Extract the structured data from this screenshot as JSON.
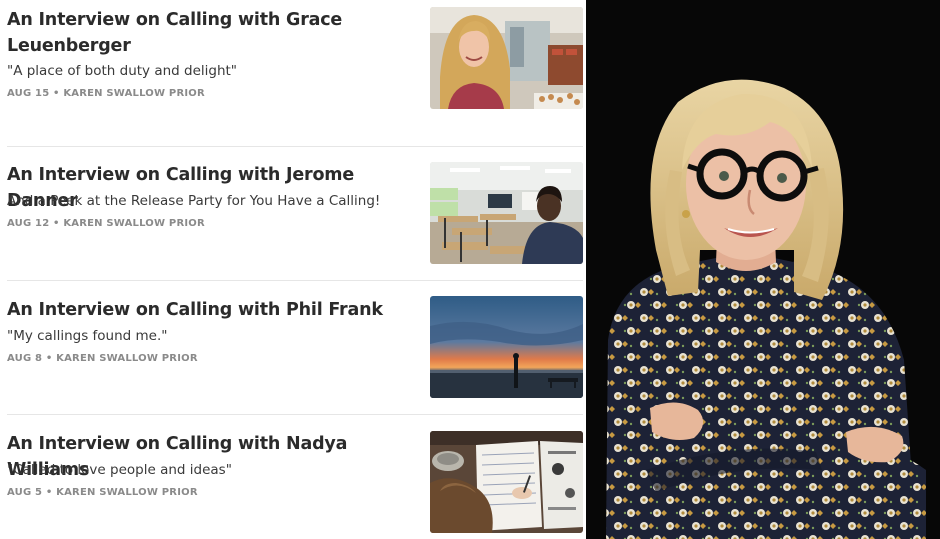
{
  "posts": [
    {
      "title": "An Interview on Calling with Grace Leuenberger",
      "subtitle": "\"A place of both duty and delight\"",
      "date": "AUG 15",
      "author": "KAREN SWALLOW PRIOR",
      "thumbnail_icon": "woman-in-kitchen-photo"
    },
    {
      "title": "An Interview on Calling with Jerome Danner",
      "subtitle": "And a Peek at the Release Party for You Have a Calling!",
      "date": "AUG 12",
      "author": "KAREN SWALLOW PRIOR",
      "thumbnail_icon": "classroom-photo"
    },
    {
      "title": "An Interview on Calling with Phil Frank",
      "subtitle": "\"My callings found me.\"",
      "date": "AUG 8",
      "author": "KAREN SWALLOW PRIOR",
      "thumbnail_icon": "beach-sunset-photo"
    },
    {
      "title": "An Interview on Calling with Nadya Williams",
      "subtitle": "\"Called to love people and ideas\"",
      "date": "AUG 5",
      "author": "KAREN SWALLOW PRIOR",
      "thumbnail_icon": "child-writing-photo"
    }
  ],
  "meta_separator": "•",
  "portrait": {
    "icon": "author-portrait-photo"
  },
  "colors": {
    "title": "#2b2b2b",
    "meta": "#8a8a8a",
    "divider": "#e6e6e6",
    "portrait_background": "#070707"
  }
}
